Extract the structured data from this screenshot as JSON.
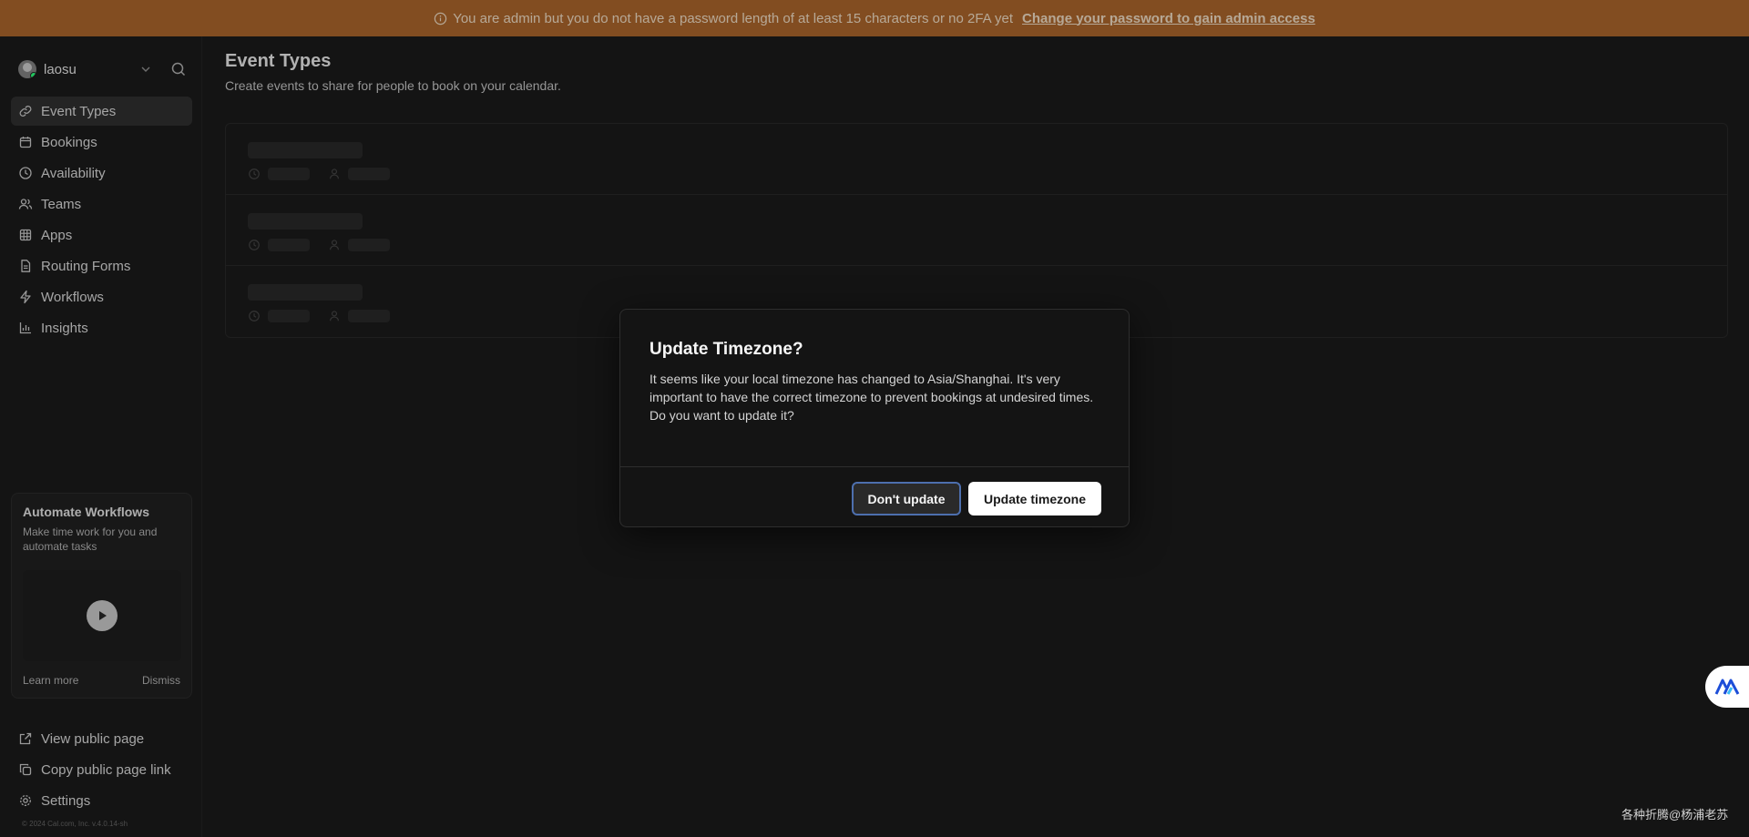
{
  "banner": {
    "message": "You are admin but you do not have a password length of at least 15 characters or no 2FA yet",
    "link": "Change your password to gain admin access"
  },
  "user": {
    "name": "laosu"
  },
  "sidebar": {
    "items": [
      {
        "label": "Event Types",
        "icon": "link-icon",
        "active": true
      },
      {
        "label": "Bookings",
        "icon": "calendar-icon"
      },
      {
        "label": "Availability",
        "icon": "clock-icon"
      },
      {
        "label": "Teams",
        "icon": "users-icon"
      },
      {
        "label": "Apps",
        "icon": "grid-icon"
      },
      {
        "label": "Routing Forms",
        "icon": "file-icon"
      },
      {
        "label": "Workflows",
        "icon": "zap-icon"
      },
      {
        "label": "Insights",
        "icon": "bar-chart-icon"
      }
    ],
    "bottom": [
      {
        "label": "View public page",
        "icon": "external-link-icon"
      },
      {
        "label": "Copy public page link",
        "icon": "copy-icon"
      },
      {
        "label": "Settings",
        "icon": "settings-icon"
      }
    ],
    "copyright": "© 2024 Cal.com, Inc. v.4.0.14-sh"
  },
  "promo": {
    "title": "Automate Workflows",
    "text": "Make time work for you and automate tasks",
    "learn_more": "Learn more",
    "dismiss": "Dismiss"
  },
  "main": {
    "title": "Event Types",
    "subtitle": "Create events to share for people to book on your calendar."
  },
  "modal": {
    "title": "Update Timezone?",
    "body": "It seems like your local timezone has changed to Asia/Shanghai. It's very important to have the correct timezone to prevent bookings at undesired times. Do you want to update it?",
    "cancel_label": "Don't update",
    "confirm_label": "Update timezone"
  },
  "watermark": "各种折腾@杨浦老苏",
  "colors": {
    "banner": "#b56b2e",
    "primary_button": "#ffffff",
    "focus_ring": "#4d6fae"
  }
}
